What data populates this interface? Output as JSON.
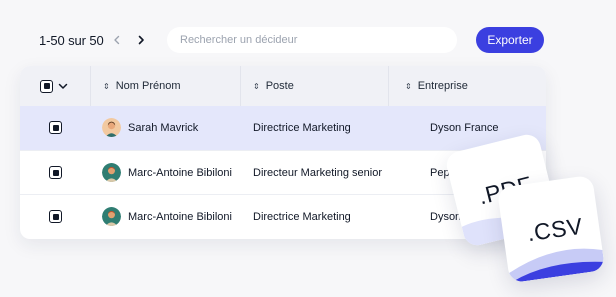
{
  "toolbar": {
    "pagination": "1-50 sur 50",
    "search_placeholder": "Rechercher un décideur",
    "export_label": "Exporter"
  },
  "table": {
    "columns": [
      {
        "label": "Nom Prénom"
      },
      {
        "label": "Poste"
      },
      {
        "label": "Entreprise"
      }
    ],
    "rows": [
      {
        "name": "Sarah Mavrick",
        "poste": "Directrice Marketing",
        "entreprise": "Dyson France",
        "selected": true
      },
      {
        "name": "Marc-Antoine Bibiloni",
        "poste": "Directeur Marketing senior",
        "entreprise": "Pepsico",
        "selected": false
      },
      {
        "name": "Marc-Antoine Bibiloni",
        "poste": "Directrice Marketing",
        "entreprise": "Dyson",
        "selected": false
      }
    ]
  },
  "files": {
    "pdf": ".PDF",
    "csv": ".CSV"
  },
  "colors": {
    "accent": "#3b3fe0",
    "selected_row": "#e4e7fb",
    "wave": "#c7cbf6"
  }
}
